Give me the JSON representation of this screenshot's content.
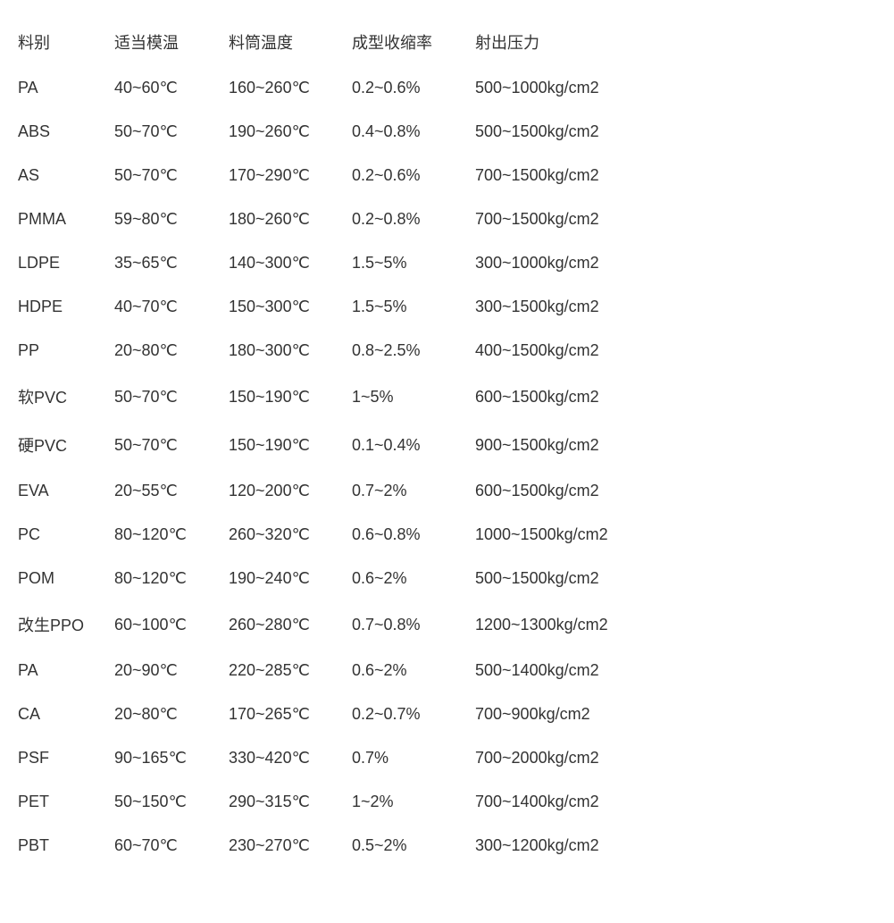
{
  "table": {
    "headers": {
      "material": "料别",
      "mold_temp": "适当模温",
      "barrel_temp": "料筒温度",
      "shrinkage": "成型收缩率",
      "pressure": "射出压力"
    },
    "rows": [
      {
        "material": "PA",
        "mold_temp": "40~60℃",
        "barrel_temp": "160~260℃",
        "shrinkage": "0.2~0.6%",
        "pressure": "500~1000kg/cm2"
      },
      {
        "material": "ABS",
        "mold_temp": "50~70℃",
        "barrel_temp": "190~260℃",
        "shrinkage": "0.4~0.8%",
        "pressure": "500~1500kg/cm2"
      },
      {
        "material": "AS",
        "mold_temp": "50~70℃",
        "barrel_temp": "170~290℃",
        "shrinkage": "0.2~0.6%",
        "pressure": "700~1500kg/cm2"
      },
      {
        "material": "PMMA",
        "mold_temp": "59~80℃",
        "barrel_temp": "180~260℃",
        "shrinkage": "0.2~0.8%",
        "pressure": "700~1500kg/cm2"
      },
      {
        "material": "LDPE",
        "mold_temp": "35~65℃",
        "barrel_temp": "140~300℃",
        "shrinkage": "1.5~5%",
        "pressure": "300~1000kg/cm2"
      },
      {
        "material": "HDPE",
        "mold_temp": "40~70℃",
        "barrel_temp": "150~300℃",
        "shrinkage": "1.5~5%",
        "pressure": "300~1500kg/cm2"
      },
      {
        "material": "PP",
        "mold_temp": "20~80℃",
        "barrel_temp": "180~300℃",
        "shrinkage": "0.8~2.5%",
        "pressure": "400~1500kg/cm2"
      },
      {
        "material": "软PVC",
        "mold_temp": "50~70℃",
        "barrel_temp": "150~190℃",
        "shrinkage": "1~5%",
        "pressure": "600~1500kg/cm2"
      },
      {
        "material": "硬PVC",
        "mold_temp": "50~70℃",
        "barrel_temp": "150~190℃",
        "shrinkage": "0.1~0.4%",
        "pressure": "900~1500kg/cm2"
      },
      {
        "material": "EVA",
        "mold_temp": "20~55℃",
        "barrel_temp": "120~200℃",
        "shrinkage": "0.7~2%",
        "pressure": "600~1500kg/cm2"
      },
      {
        "material": "PC",
        "mold_temp": "80~120℃",
        "barrel_temp": "260~320℃",
        "shrinkage": "0.6~0.8%",
        "pressure": "1000~1500kg/cm2"
      },
      {
        "material": "POM",
        "mold_temp": "80~120℃",
        "barrel_temp": "190~240℃",
        "shrinkage": "0.6~2%",
        "pressure": "500~1500kg/cm2"
      },
      {
        "material": "改生PPO",
        "mold_temp": "60~100℃",
        "barrel_temp": "260~280℃",
        "shrinkage": "0.7~0.8%",
        "pressure": "1200~1300kg/cm2"
      },
      {
        "material": "PA",
        "mold_temp": "20~90℃",
        "barrel_temp": "220~285℃",
        "shrinkage": "0.6~2%",
        "pressure": "500~1400kg/cm2"
      },
      {
        "material": "CA",
        "mold_temp": "20~80℃",
        "barrel_temp": "170~265℃",
        "shrinkage": "0.2~0.7%",
        "pressure": "700~900kg/cm2"
      },
      {
        "material": "PSF",
        "mold_temp": "90~165℃",
        "barrel_temp": "330~420℃",
        "shrinkage": "0.7%",
        "pressure": "700~2000kg/cm2"
      },
      {
        "material": "PET",
        "mold_temp": "50~150℃",
        "barrel_temp": "290~315℃",
        "shrinkage": "1~2%",
        "pressure": "700~1400kg/cm2"
      },
      {
        "material": "PBT",
        "mold_temp": "60~70℃",
        "barrel_temp": "230~270℃",
        "shrinkage": "0.5~2%",
        "pressure": "300~1200kg/cm2"
      }
    ]
  }
}
